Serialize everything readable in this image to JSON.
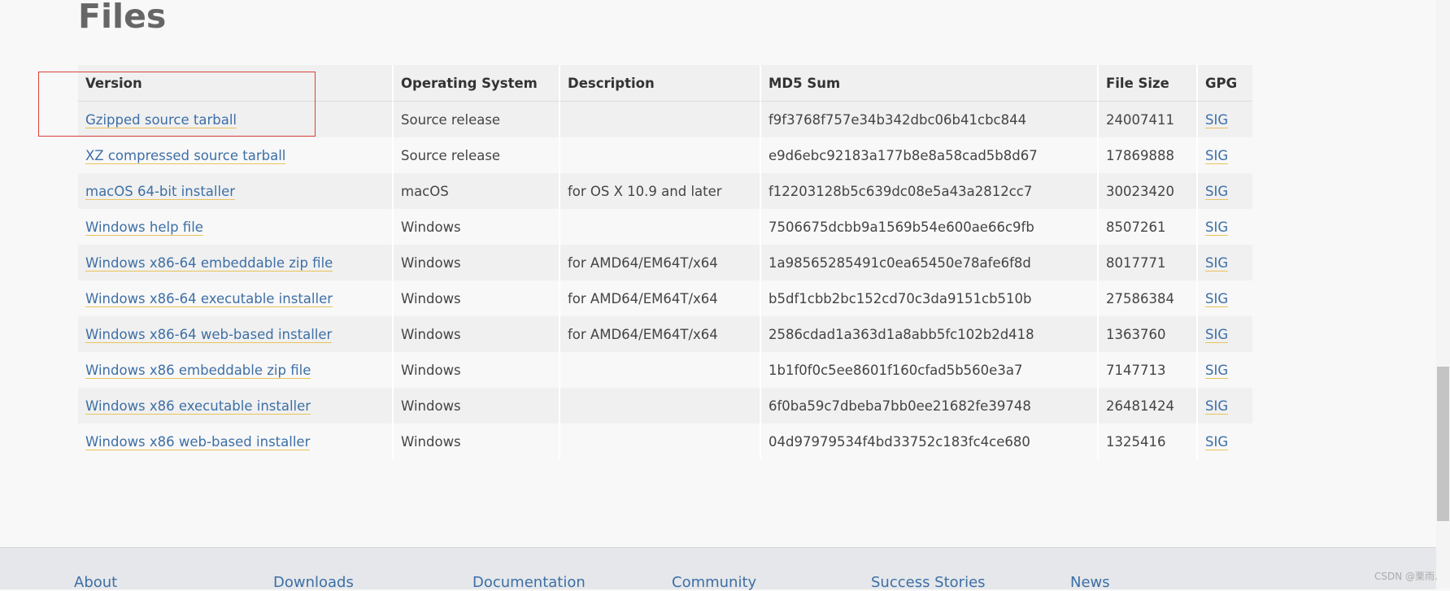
{
  "page": {
    "title": "Files"
  },
  "table": {
    "headers": {
      "version": "Version",
      "os": "Operating System",
      "description": "Description",
      "md5": "MD5 Sum",
      "size": "File Size",
      "gpg": "GPG"
    },
    "rows": [
      {
        "version": "Gzipped source tarball",
        "os": "Source release",
        "description": "",
        "md5": "f9f3768f757e34b342dbc06b41cbc844",
        "size": "24007411",
        "gpg": "SIG"
      },
      {
        "version": "XZ compressed source tarball",
        "os": "Source release",
        "description": "",
        "md5": "e9d6ebc92183a177b8e8a58cad5b8d67",
        "size": "17869888",
        "gpg": "SIG"
      },
      {
        "version": "macOS 64-bit installer",
        "os": "macOS",
        "description": "for OS X 10.9 and later",
        "md5": "f12203128b5c639dc08e5a43a2812cc7",
        "size": "30023420",
        "gpg": "SIG"
      },
      {
        "version": "Windows help file",
        "os": "Windows",
        "description": "",
        "md5": "7506675dcbb9a1569b54e600ae66c9fb",
        "size": "8507261",
        "gpg": "SIG"
      },
      {
        "version": "Windows x86-64 embeddable zip file",
        "os": "Windows",
        "description": "for AMD64/EM64T/x64",
        "md5": "1a98565285491c0ea65450e78afe6f8d",
        "size": "8017771",
        "gpg": "SIG"
      },
      {
        "version": "Windows x86-64 executable installer",
        "os": "Windows",
        "description": "for AMD64/EM64T/x64",
        "md5": "b5df1cbb2bc152cd70c3da9151cb510b",
        "size": "27586384",
        "gpg": "SIG"
      },
      {
        "version": "Windows x86-64 web-based installer",
        "os": "Windows",
        "description": "for AMD64/EM64T/x64",
        "md5": "2586cdad1a363d1a8abb5fc102b2d418",
        "size": "1363760",
        "gpg": "SIG"
      },
      {
        "version": "Windows x86 embeddable zip file",
        "os": "Windows",
        "description": "",
        "md5": "1b1f0f0c5ee8601f160cfad5b560e3a7",
        "size": "7147713",
        "gpg": "SIG"
      },
      {
        "version": "Windows x86 executable installer",
        "os": "Windows",
        "description": "",
        "md5": "6f0ba59c7dbeba7bb0ee21682fe39748",
        "size": "26481424",
        "gpg": "SIG"
      },
      {
        "version": "Windows x86 web-based installer",
        "os": "Windows",
        "description": "",
        "md5": "04d97979534f4bd33752c183fc4ce680",
        "size": "1325416",
        "gpg": "SIG"
      }
    ]
  },
  "footer": {
    "links": [
      "About",
      "Downloads",
      "Documentation",
      "Community",
      "Success Stories",
      "News"
    ]
  },
  "watermark": "CSDN @栗雨.",
  "colors": {
    "link": "#3d6fa6",
    "link_underline": "#e8c45a",
    "highlight_box": "#d9413a",
    "row_stripe": "#f0f0f0",
    "footer_bg": "#e5e7ea"
  }
}
